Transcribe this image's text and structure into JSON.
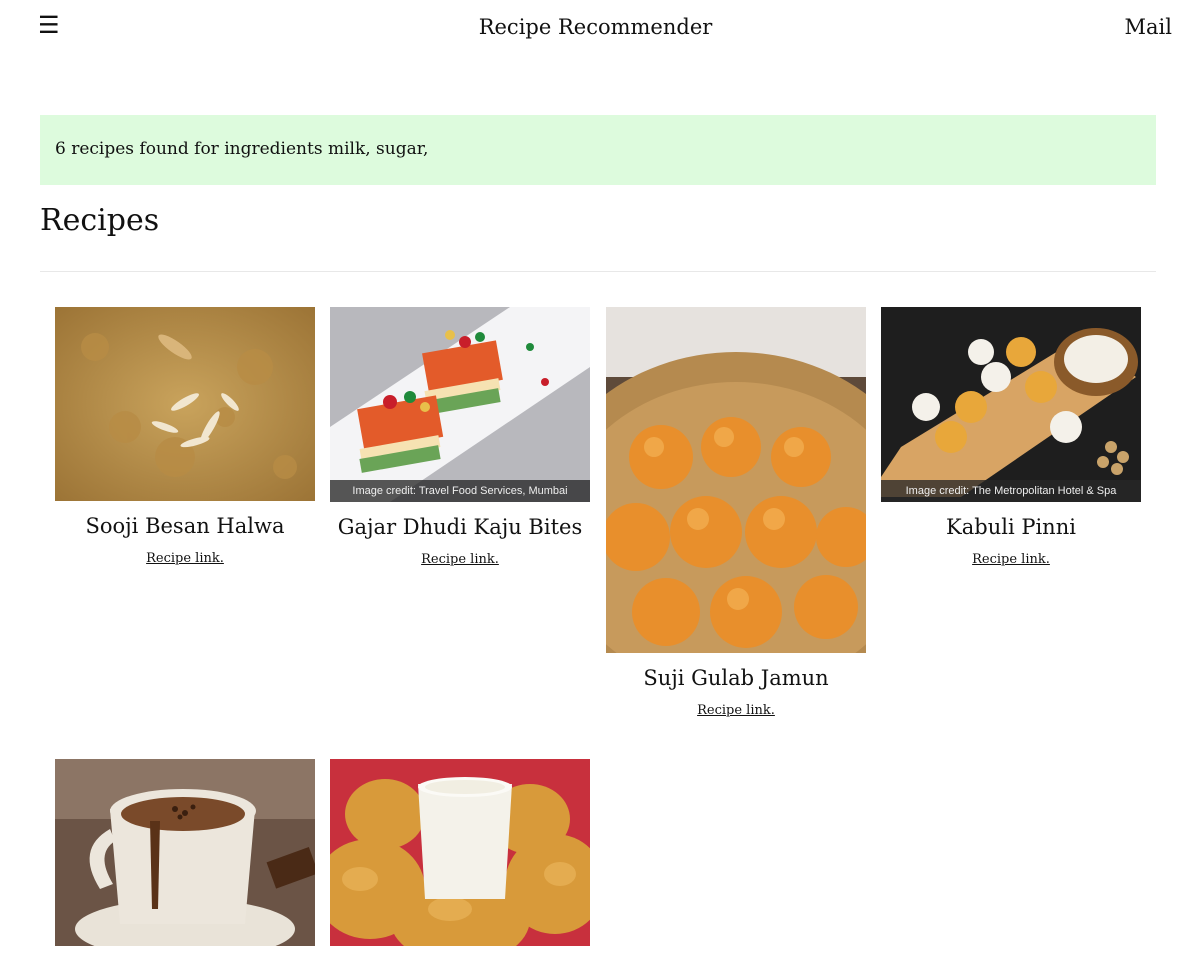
{
  "header": {
    "menu_icon": "hamburger-menu-icon",
    "menu_glyph": "☰",
    "title": "Recipe Recommender",
    "mail_label": "Mail"
  },
  "alert": {
    "text": "6 recipes found for ingredients milk, sugar,",
    "bg_color": "#ddfbdd"
  },
  "section": {
    "title": "Recipes"
  },
  "recipes": [
    {
      "title": "Sooji Besan Halwa",
      "link_label": "Recipe link.",
      "image_credit": ""
    },
    {
      "title": "Gajar Dhudi Kaju Bites",
      "link_label": "Recipe link.",
      "image_credit": "Image credit: Travel Food Services, Mumbai"
    },
    {
      "title": "Suji Gulab Jamun",
      "link_label": "Recipe link.",
      "image_credit": ""
    },
    {
      "title": "Kabuli Pinni",
      "link_label": "Recipe link.",
      "image_credit": "Image credit: The Metropolitan Hotel & Spa"
    },
    {
      "title": "",
      "link_label": "",
      "image_credit": ""
    },
    {
      "title": "",
      "link_label": "",
      "image_credit": ""
    }
  ]
}
